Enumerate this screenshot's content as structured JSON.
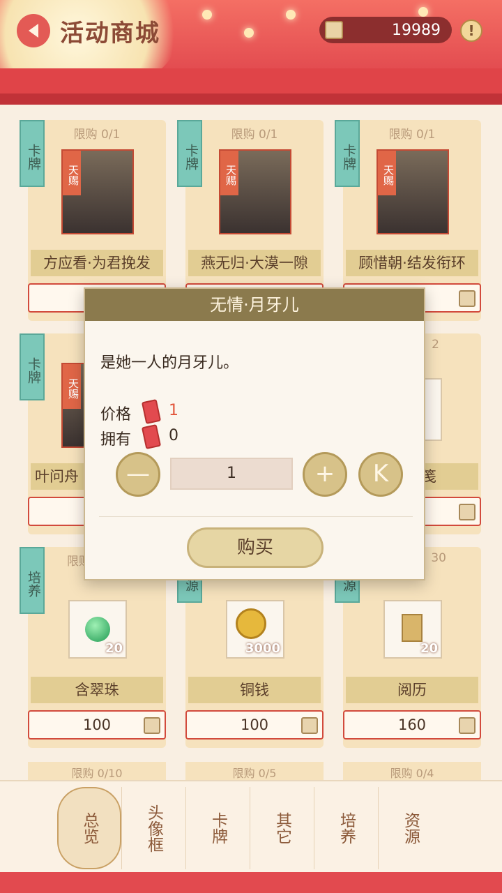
{
  "header": {
    "title": "活动商城",
    "coins": "19989",
    "info_label": "!"
  },
  "cards": [
    {
      "tag": "卡牌",
      "limit": "限购 0/1",
      "name": "方应看·为君挽发",
      "badge": "天赐"
    },
    {
      "tag": "卡牌",
      "limit": "限购 0/1",
      "name": "燕无归·大漠一隙",
      "badge": "天赐"
    },
    {
      "tag": "卡牌",
      "limit": "限购 0/1",
      "name": "顾惜朝·结发衔环",
      "badge": "天赐"
    },
    {
      "tag": "卡牌",
      "limit": "限",
      "name": "叶问舟",
      "badge": "天赐"
    },
    {
      "tag": "",
      "limit": "2",
      "name": "笺",
      "badge": ""
    },
    {
      "tag": "培养",
      "limit": "限购",
      "name": "含翠珠",
      "qty": "20",
      "price": "100"
    },
    {
      "tag": "资源",
      "limit": "",
      "name": "铜钱",
      "qty": "3000",
      "price": "100"
    },
    {
      "tag": "资源",
      "limit": "30",
      "name": "阅历",
      "qty": "20",
      "price": "160"
    }
  ],
  "next_row_limits": [
    "限购 0/10",
    "限购 0/5",
    "限购 0/4"
  ],
  "tabs": [
    "总览",
    "头像框",
    "卡牌",
    "其它",
    "培养",
    "资源"
  ],
  "modal": {
    "title": "无情·月牙儿",
    "description": "是她一人的月牙儿。",
    "price_label": "价格",
    "price_value": "1",
    "own_label": "拥有",
    "own_value": "0",
    "quantity": "1",
    "minus": "—",
    "plus": "+",
    "max": "K",
    "buy_label": "购买"
  },
  "colors": {
    "accent": "#e24a4f",
    "gold": "#d7c289",
    "modal_header": "#8b7a4d"
  }
}
